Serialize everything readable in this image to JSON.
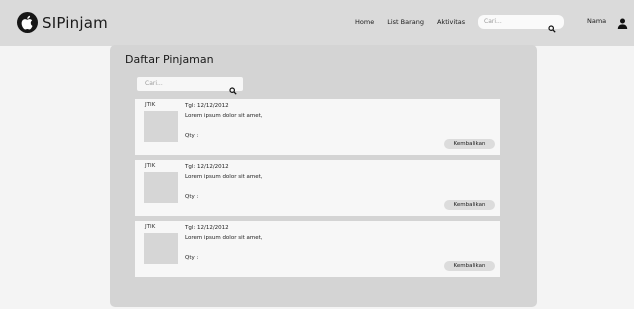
{
  "navbar": {
    "brand": "SIPinjam",
    "links": [
      "Home",
      "List Barang",
      "Aktivitas"
    ],
    "search_placeholder": "Cari...",
    "user_name": "Nama"
  },
  "panel": {
    "title": "Daftar Pinjaman",
    "search_placeholder": "Cari...",
    "loans": [
      {
        "code": "JTIK",
        "date": "Tgl: 12/12/2012",
        "description": "Lorem ipsum dolor sit amet,",
        "qty": "Qty :",
        "action": "Kembalikan"
      },
      {
        "code": "JTIK",
        "date": "Tgl: 12/12/2012",
        "description": "Lorem ipsum dolor sit amet,",
        "qty": "Qty :",
        "action": "Kembalikan"
      },
      {
        "code": "JTIK",
        "date": "Tgl: 12/12/2012",
        "description": "Lorem ipsum dolor sit amet,",
        "qty": "Qty :",
        "action": "Kembalikan"
      }
    ]
  },
  "colors": {
    "navbar_bg": "#dadada",
    "page_bg": "#f4f4f4",
    "panel_bg": "#d4d4d4",
    "card_bg": "#f7f7f7",
    "button_bg": "#dcdcdc"
  },
  "icons": [
    "apple-logo-icon",
    "search-icon",
    "user-icon"
  ]
}
